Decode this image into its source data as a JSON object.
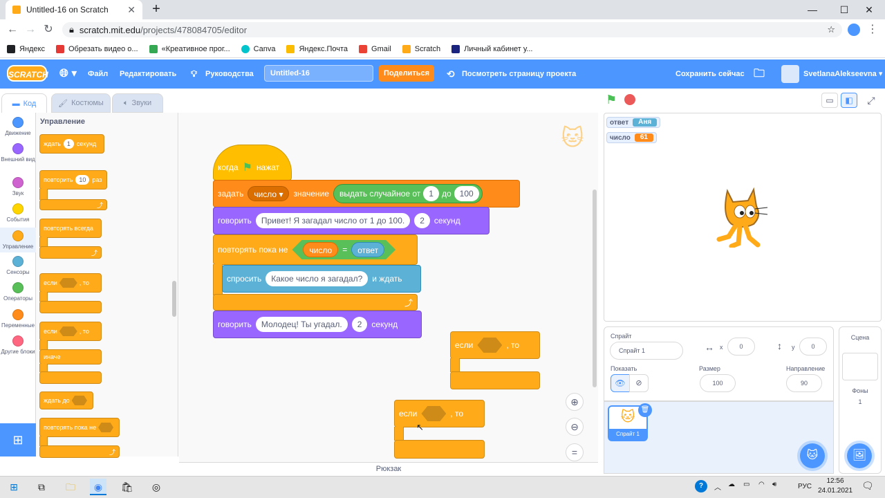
{
  "browser": {
    "tab_title": "Untitled-16 on Scratch",
    "url_host": "scratch.mit.edu",
    "url_path": "/projects/478084705/editor",
    "bookmarks": [
      {
        "label": "Яндекс",
        "color": "#202124"
      },
      {
        "label": "Обрезать видео о...",
        "color": "#e53935"
      },
      {
        "label": "«Креативное прог...",
        "color": "#34a853"
      },
      {
        "label": "Canva",
        "color": "#00c4cc"
      },
      {
        "label": "Яндекс.Почта",
        "color": "#fbbc04"
      },
      {
        "label": "Gmail",
        "color": "#ea4335"
      },
      {
        "label": "Scratch",
        "color": "#ffab19"
      },
      {
        "label": "Личный кабинет у...",
        "color": "#1a237e"
      }
    ]
  },
  "menu": {
    "logo": "SCRATCH",
    "file": "Файл",
    "edit": "Редактировать",
    "tutorials": "Руководства",
    "project_title": "Untitled-16",
    "share": "Поделиться",
    "see_project": "Посмотреть страницу проекта",
    "save_now": "Сохранить сейчас",
    "username": "SvetlanaAlekseevna"
  },
  "tabs": {
    "code": "Код",
    "costumes": "Костюмы",
    "sounds": "Звуки"
  },
  "categories": [
    {
      "label": "Движение",
      "color": "#4c97ff"
    },
    {
      "label": "Внешний вид",
      "color": "#9966ff"
    },
    {
      "label": "Звук",
      "color": "#cf63cf"
    },
    {
      "label": "События",
      "color": "#ffd500"
    },
    {
      "label": "Управление",
      "color": "#ffab19"
    },
    {
      "label": "Сенсоры",
      "color": "#5cb1d6"
    },
    {
      "label": "Операторы",
      "color": "#59c059"
    },
    {
      "label": "Переменные",
      "color": "#ff8c1a"
    },
    {
      "label": "Другие блоки",
      "color": "#ff6680"
    }
  ],
  "palette": {
    "title": "Управление",
    "wait": "ждать",
    "wait_val": "1",
    "wait_unit": "секунд",
    "repeat": "повторить",
    "repeat_val": "10",
    "repeat_unit": "раз",
    "forever": "повторять всегда",
    "if": "если",
    "then": ", то",
    "else": "иначе",
    "wait_until": "ждать до",
    "repeat_until": "повторять пока не"
  },
  "script": {
    "when": "когда",
    "clicked": "нажат",
    "set": "задать",
    "var_name": "число",
    "to": "значение",
    "pick": "выдать случайное от",
    "from": "1",
    "upto": "до",
    "to_val": "100",
    "say": "говорить",
    "say_text": "Привет! Я загадал число от 1 до 100.",
    "say_secs": "2",
    "secs": "секунд",
    "repeat_until": "повторять пока не",
    "rep_var": "число",
    "eq": "=",
    "answer": "ответ",
    "ask": "спросить",
    "ask_text": "Какое число я загадал?",
    "and_wait": "и ждать",
    "say2": "говорить",
    "say2_text": "Молодец! Ты угадал.",
    "say2_secs": "2",
    "secs2": "секунд",
    "if_a": "если",
    "then_a": ", то",
    "if_b": "если",
    "then_b": ", то"
  },
  "backpack": "Рюкзак",
  "monitors": [
    {
      "name": "ответ",
      "value": "Аня",
      "color": "#5cb1d6"
    },
    {
      "name": "число",
      "value": "61",
      "color": "#ff8c1a"
    }
  ],
  "sprite_info": {
    "sprite_label": "Спрайт",
    "sprite_name": "Спрайт 1",
    "x_label": "x",
    "x": "0",
    "y_label": "y",
    "y": "0",
    "show_label": "Показать",
    "size_label": "Размер",
    "size": "100",
    "dir_label": "Направление",
    "dir": "90"
  },
  "sprite_thumb": "Спрайт 1",
  "scene": {
    "title": "Сцена",
    "backdrops_label": "Фоны",
    "backdrops_count": "1"
  },
  "taskbar": {
    "lang": "РУС",
    "time": "12:56",
    "date": "24.01.2021"
  }
}
